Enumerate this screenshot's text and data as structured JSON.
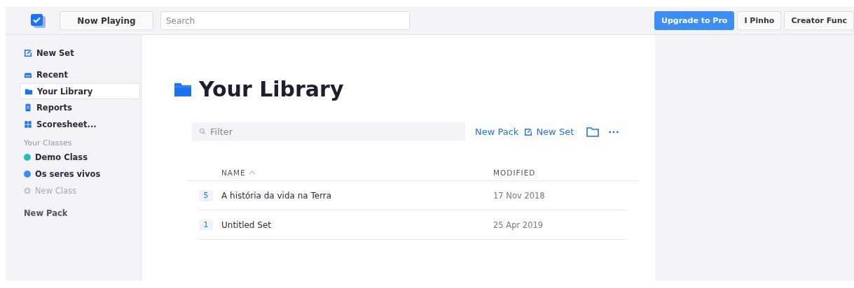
{
  "topbar": {
    "now_playing": "Now Playing",
    "search": {
      "placeholder": "Search"
    },
    "buttons": [
      {
        "label": "Upgrade to Pro",
        "kind": "primary"
      },
      {
        "label": "I Pinho",
        "kind": "plain"
      },
      {
        "label": "Creator Func",
        "kind": "plain"
      }
    ]
  },
  "sidebar": {
    "new_set": "New Set",
    "items": [
      {
        "label": "Recent",
        "kind": "tray",
        "selected": false
      },
      {
        "label": "Your Library",
        "kind": "folder",
        "selected": true
      },
      {
        "label": "Reports",
        "kind": "report",
        "selected": false
      },
      {
        "label": "Scoresheet...",
        "kind": "grid",
        "selected": false
      }
    ],
    "classes_header": "Your Classes",
    "classes": [
      {
        "label": "Demo Class",
        "color": "#1ec0c0"
      },
      {
        "label": "Os seres vivos",
        "color": "#3b8ef5"
      }
    ],
    "new_class": {
      "label": "New Class",
      "disabled": true
    },
    "new_pack": "New Pack"
  },
  "main": {
    "title": "Your Library",
    "filter": {
      "placeholder": "Filter"
    },
    "actions": {
      "new_pack": "New Pack",
      "new_set": "New Set"
    },
    "table": {
      "columns": [
        {
          "label": "NAME",
          "sorted": true
        },
        {
          "label": "MODIFIED",
          "sorted": false
        }
      ],
      "rows": [
        {
          "count": "5",
          "name": "A história da vida na Terra",
          "modified": "17 Nov 2018"
        },
        {
          "count": "1",
          "name": "Untitled Set",
          "modified": "25 Apr 2019"
        }
      ]
    }
  }
}
